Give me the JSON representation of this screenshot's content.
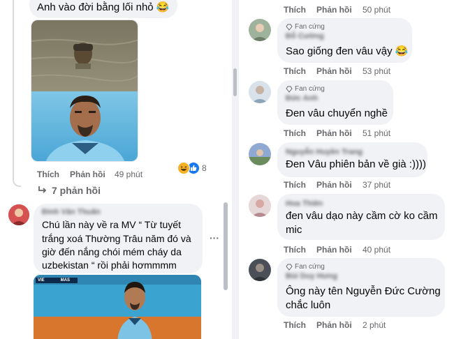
{
  "left_column": {
    "top_comment": {
      "text": "Anh vào đời bằng lối nhỏ 😂"
    },
    "meme_comment": {
      "like": "Thích",
      "reply": "Phản hồi",
      "time": "49 phút",
      "reaction_count": "8",
      "replies_link": "7 phản hồi"
    },
    "second_comment": {
      "author": "Đinh Văn Thuấn",
      "lines": [
        "Chú lần này về ra MV “ Từ tuyết",
        "trắng xoá Thường Trâu năm đó và",
        "giờ đến nắng chói mém cháy da",
        "uzbekistan “ rồi phải hơmmmm"
      ],
      "more": "···",
      "score_home": "VIE",
      "score_away": "MAS"
    }
  },
  "right_column": {
    "top_actions": {
      "like": "Thích",
      "reply": "Phản hồi",
      "time": "50 phút"
    },
    "comments": [
      {
        "badge": "Fan cứng",
        "author": "Đỗ Cường",
        "lines": [
          "Sao giống đen vâu vậy 😂"
        ],
        "like": "Thích",
        "reply": "Phản hồi",
        "time": "53 phút"
      },
      {
        "badge": "Fan cứng",
        "author": "Đức Anh",
        "lines": [
          "Đen vâu chuyển nghề"
        ],
        "like": "Thích",
        "reply": "Phản hồi",
        "time": "51 phút"
      },
      {
        "author": "Nguyễn Huyền Trang",
        "lines": [
          "Đen Vâu phiên bản về già :))))"
        ],
        "like": "Thích",
        "reply": "Phản hồi",
        "time": "37 phút"
      },
      {
        "author": "Hoa Thiên",
        "lines": [
          "đen vâu dạo này cầm cờ ko cầm",
          "mic"
        ],
        "like": "Thích",
        "reply": "Phản hồi",
        "time": "40 phút"
      },
      {
        "badge": "Fan cứng",
        "author": "Bùi Duy Hưng",
        "lines": [
          "Ông này tên Nguyễn Đức Cường",
          "chắc luôn"
        ],
        "like": "Thích",
        "reply": "Phản hồi",
        "time": "2 phút"
      }
    ]
  },
  "colors": {
    "bubble": "#f0f2f5",
    "secondary_text": "#65676b",
    "like_blue": "#1877f2",
    "haha_yellow": "#f7b125"
  }
}
